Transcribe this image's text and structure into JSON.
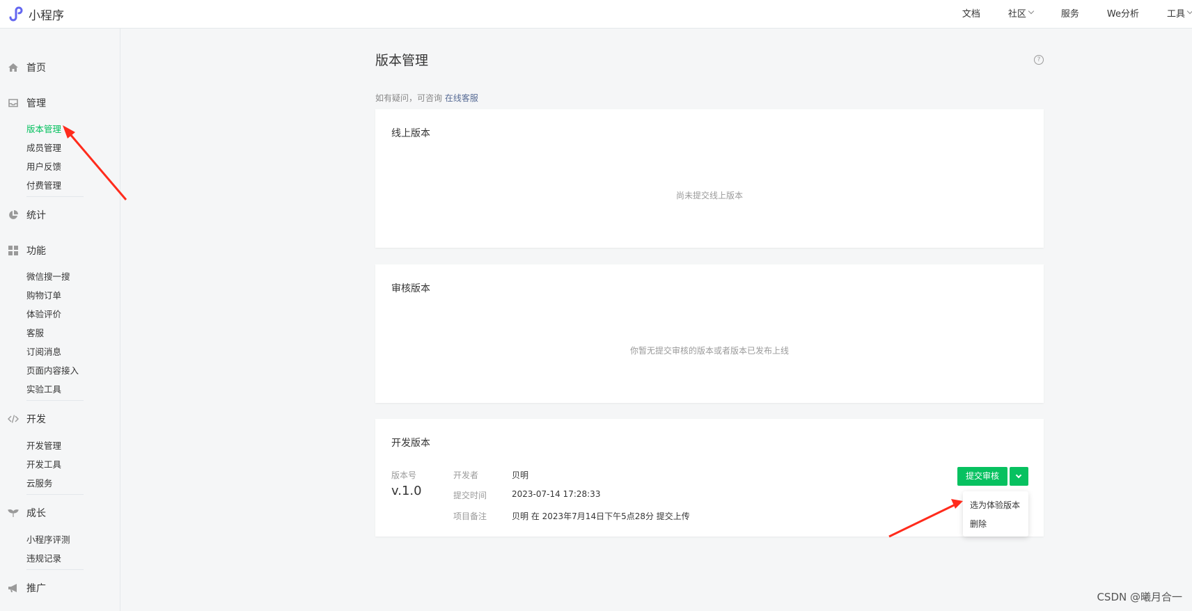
{
  "header": {
    "logo_text": "小程序",
    "nav": [
      {
        "label": "文档",
        "dropdown": false
      },
      {
        "label": "社区",
        "dropdown": true
      },
      {
        "label": "服务",
        "dropdown": false
      },
      {
        "label": "We分析",
        "dropdown": false
      },
      {
        "label": "工具",
        "dropdown": true
      }
    ]
  },
  "sidebar": {
    "home": "首页",
    "manage": {
      "label": "管理",
      "items": [
        "版本管理",
        "成员管理",
        "用户反馈",
        "付费管理"
      ]
    },
    "stats": "统计",
    "features": {
      "label": "功能",
      "items": [
        "微信搜一搜",
        "购物订单",
        "体验评价",
        "客服",
        "订阅消息",
        "页面内容接入",
        "实验工具"
      ]
    },
    "dev": {
      "label": "开发",
      "items": [
        "开发管理",
        "开发工具",
        "云服务"
      ]
    },
    "growth": {
      "label": "成长",
      "items": [
        "小程序评测",
        "违规记录"
      ]
    },
    "promote": "推广"
  },
  "main": {
    "title": "版本管理",
    "tip_text": "如有疑问，可咨询",
    "tip_link": "在线客服",
    "online": {
      "title": "线上版本",
      "empty": "尚未提交线上版本"
    },
    "review": {
      "title": "审核版本",
      "empty": "你暂无提交审核的版本或者版本已发布上线"
    },
    "dev": {
      "title": "开发版本",
      "version_label": "版本号",
      "version": "v.1.0",
      "developer_label": "开发者",
      "developer": "贝明",
      "time_label": "提交时间",
      "time": "2023-07-14 17:28:33",
      "note_label": "项目备注",
      "note": "贝明 在 2023年7月14日下午5点28分 提交上传",
      "submit_button": "提交审核",
      "dropdown": [
        "选为体验版本",
        "删除"
      ]
    }
  },
  "watermark": "CSDN @曦月合一",
  "colors": {
    "accent": "#07c160",
    "link": "#576b95",
    "annotation_arrow": "#ff2b1c"
  }
}
